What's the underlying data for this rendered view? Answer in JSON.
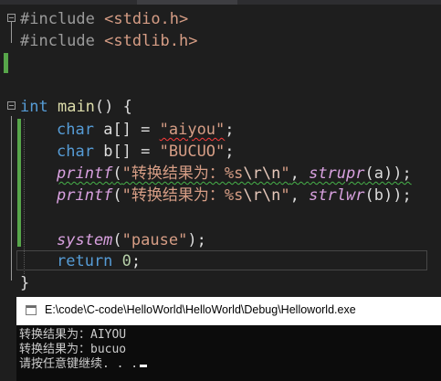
{
  "editor": {
    "lines": {
      "l1": {
        "directive": "#include",
        "header": "<stdio.h>"
      },
      "l2": {
        "directive": "#include",
        "header": "<stdlib.h>"
      },
      "l5": {
        "type": "int",
        "name": "main",
        "parens": "()",
        "brace": "{"
      },
      "l6": {
        "type": "char",
        "decl": "a[] = ",
        "str": "\"aiyou\"",
        "semi": ";"
      },
      "l7": {
        "type": "char",
        "decl": "b[] = ",
        "str": "\"BUCUO\"",
        "semi": ";"
      },
      "l8": {
        "fn": "printf",
        "open": "(",
        "str_a": "\"转换结果为：%s",
        "esc": "\\r\\n",
        "str_b": "\"",
        "comma": ", ",
        "fn2": "strupr",
        "args": "(a));"
      },
      "l9": {
        "fn": "printf",
        "open": "(",
        "str_a": "\"转换结果为：%s",
        "esc": "\\r\\n",
        "str_b": "\"",
        "comma": ", ",
        "fn2": "strlwr",
        "args": "(b));"
      },
      "l11": {
        "fn": "system",
        "open": "(",
        "str": "\"pause\"",
        "close": ");"
      },
      "l12": {
        "kw": "return",
        "num": "0",
        "semi": ";"
      },
      "l13": {
        "brace": "}"
      }
    }
  },
  "console": {
    "title": "E:\\code\\C-code\\HelloWorld\\HelloWorld\\Debug\\Helloworld.exe",
    "out1": "转换结果为：AIYOU",
    "out2": "转换结果为：bucuo",
    "out3": "请按任意键继续. . ."
  },
  "colors": {
    "background": "#1e1e1e",
    "keyword": "#569cd6",
    "string": "#d69d85",
    "function": "#d8a0df",
    "number": "#b5cea8",
    "change_marker": "#57a64a"
  }
}
